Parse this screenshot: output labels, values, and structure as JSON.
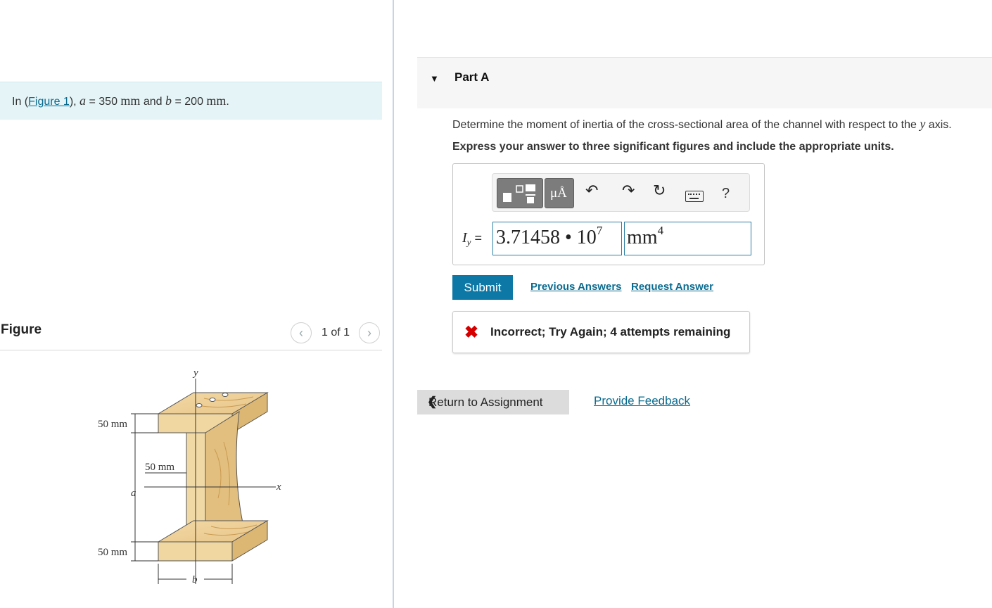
{
  "problem": {
    "prefix": "In (",
    "figure_link": "Figure 1",
    "suffix": "), ",
    "var_a": "a",
    "equals_a": " = 350 ",
    "unit_a": "mm",
    "and": " and ",
    "var_b": "b",
    "equals_b": " = 200 ",
    "unit_b": "mm",
    "period": "."
  },
  "figure": {
    "heading": "Figure",
    "prev_icon": "chevron-left-icon",
    "next_icon": "chevron-right-icon",
    "count": "1 of 1",
    "labels": {
      "top_flange": "50 mm",
      "web": "50 mm",
      "bottom_flange": "50 mm",
      "y_axis": "y",
      "x_axis": "x",
      "a": "a",
      "b": "b"
    }
  },
  "part": {
    "title": "Part A",
    "caret_icon": "triangle-down-icon",
    "question_prefix": "Determine the moment of inertia of the cross-sectional area of the channel with respect to the ",
    "question_var": "y",
    "question_suffix": " axis.",
    "instruction": "Express your answer to three significant figures and include the appropriate units."
  },
  "toolbar": {
    "template_icon": "fraction-template-icon",
    "units_button": "μÅ",
    "undo_icon": "undo-icon",
    "redo_icon": "redo-icon",
    "reset_icon": "reset-icon",
    "keyboard_icon": "keyboard-icon",
    "help": "?"
  },
  "answer": {
    "var": "I",
    "var_sub": "y",
    "equals": " =",
    "value_mantissa": "3.71458 • 10",
    "value_exponent": "7",
    "units_base": "mm",
    "units_exponent": "4"
  },
  "actions": {
    "submit": "Submit",
    "previous_answers": "Previous Answers",
    "request_answer": "Request Answer"
  },
  "feedback": {
    "icon": "x-icon",
    "mark": "✖",
    "text": "Incorrect; Try Again; 4 attempts remaining"
  },
  "footer": {
    "return_label": "Return to Assignment",
    "return_icon": "chevron-left-icon",
    "provide_feedback": "Provide Feedback"
  },
  "colors": {
    "accent": "#0d78a5",
    "link": "#0a6b8f",
    "error": "#d40000",
    "problem_bg": "#e5f4f7"
  }
}
